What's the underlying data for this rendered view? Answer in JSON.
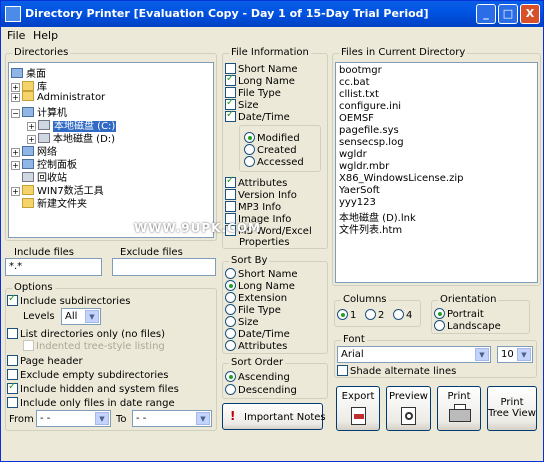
{
  "window": {
    "title": "Directory Printer [Evaluation Copy - Day 1 of 15-Day Trial Period]",
    "buttons": [
      "_",
      "□",
      "X"
    ]
  },
  "menu": [
    "File",
    "Help"
  ],
  "directories": {
    "label": "Directories",
    "tree": [
      "桌面",
      "库",
      "Administrator",
      "计算机",
      "本地磁盘 (C:)",
      "本地磁盘 (D:)",
      "网络",
      "控制面板",
      "回收站",
      "WIN7数活工具",
      "新建文件夹"
    ]
  },
  "include_files": {
    "label": "Include files",
    "value": "*.*"
  },
  "exclude_files": {
    "label": "Exclude files",
    "value": ""
  },
  "options": {
    "label": "Options",
    "include_subdirectories": "Include subdirectories",
    "levels_label": "Levels",
    "levels_value": "All",
    "list_dirs_only": "List directories only (no files)",
    "indented_tree": "Indented tree-style listing",
    "page_header": "Page header",
    "exclude_empty": "Exclude empty subdirectories",
    "include_hidden": "Include hidden and system files",
    "include_date_range": "Include only files in date range",
    "from_label": "From",
    "from_value": "- -",
    "to_label": "To",
    "to_value": "- -"
  },
  "file_information": {
    "label": "File Information",
    "short_name": "Short Name",
    "long_name": "Long Name",
    "file_type": "File Type",
    "size": "Size",
    "date_time": "Date/Time",
    "modified": "Modified",
    "created": "Created",
    "accessed": "Accessed",
    "attributes": "Attributes",
    "version_info": "Version Info",
    "mp3_info": "MP3 Info",
    "image_info": "Image Info",
    "ms_word_excel": "MS Word/Excel",
    "properties": "Properties"
  },
  "sort_by": {
    "label": "Sort By",
    "options": [
      "Short Name",
      "Long Name",
      "Extension",
      "File Type",
      "Size",
      "Date/Time",
      "Attributes"
    ]
  },
  "sort_order": {
    "label": "Sort Order",
    "options": [
      "Ascending",
      "Descending"
    ]
  },
  "important_notes": "Important Notes",
  "files_in_current_directory": {
    "label": "Files in Current Directory",
    "files": [
      "bootmgr",
      "cc.bat",
      "cllist.txt",
      "configure.ini",
      "OEMSF",
      "pagefile.sys",
      "sensecsp.log",
      "wgldr",
      "wgldr.mbr",
      "X86_WindowsLicense.zip",
      "YaerSoft",
      "yyy123",
      "本地磁盘 (D).lnk",
      "文件列表.htm"
    ]
  },
  "watermark": "WWW.9UPK.COM",
  "columns": {
    "label": "Columns",
    "options": [
      "1",
      "2",
      "4"
    ]
  },
  "orientation": {
    "label": "Orientation",
    "options": [
      "Portrait",
      "Landscape"
    ]
  },
  "font": {
    "label": "Font",
    "family": "Arial",
    "size": "10",
    "shade": "Shade alternate lines"
  },
  "actions": {
    "export": "Export",
    "preview": "Preview",
    "print": "Print",
    "print_tree_view_1": "Print",
    "print_tree_view_2": "Tree View"
  }
}
